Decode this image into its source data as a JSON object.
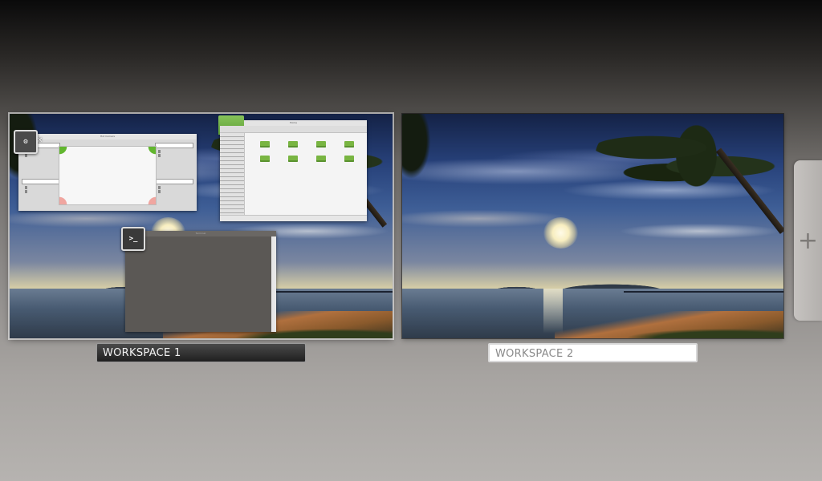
{
  "workspaces": [
    {
      "label": "WORKSPACE 1",
      "active": true,
      "windows": [
        {
          "app": "Hot Corners",
          "icon": "hot-corners-icon",
          "title": "Hot Corners",
          "dropdowns": [
            "Show all workspaces",
            "Show all windows",
            "Show all windows",
            "Show the Desktop"
          ],
          "checkboxes": [
            "Icon visible",
            "Hover enabled"
          ]
        },
        {
          "app": "Files",
          "icon": "folder-icon",
          "title": "Home",
          "folders": [
            "Desktop",
            "Documents",
            "Downloads",
            "Music",
            "Pictures",
            "Public",
            "Templates",
            "Videos"
          ]
        },
        {
          "app": "Terminal",
          "icon": "terminal-icon",
          "title": "Terminal",
          "prompt": ">_"
        }
      ]
    },
    {
      "label": "WORKSPACE 2",
      "active": false,
      "windows": []
    }
  ],
  "add_workspace": {
    "symbol": "+"
  },
  "close_symbol": "×",
  "colors": {
    "accent_green": "#62b62f",
    "corner_pink": "#f0a6a0",
    "active_label_bg": "#2c2c2c",
    "inactive_label_bg": "#ffffff"
  }
}
